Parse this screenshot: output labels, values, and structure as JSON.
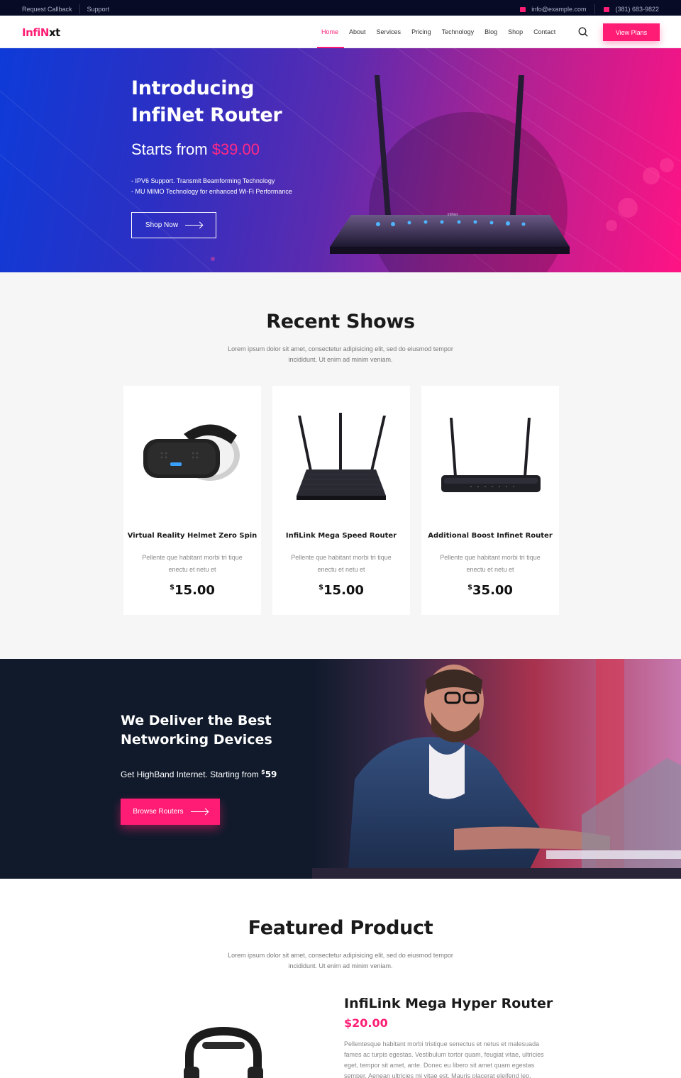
{
  "topbar": {
    "request_callback": "Request Callback",
    "support": "Support",
    "email": "info@example.com",
    "phone": "(381) 683-9822",
    "email_icon": "mail-icon",
    "phone_icon": "phone-icon"
  },
  "header": {
    "logo_part1": "InfiN",
    "logo_part2": "xt",
    "nav": [
      "Home",
      "About",
      "Services",
      "Pricing",
      "Technology",
      "Blog",
      "Shop",
      "Contact"
    ],
    "active_nav": "Home",
    "search_icon": "search-icon",
    "cta": "View Plans"
  },
  "hero": {
    "title": "Introducing InfiNet Router",
    "price_prefix": "Starts from ",
    "price": "$39.00",
    "features": [
      "- IPV6 Support. Transmit Beamforming Technology",
      "- MU MIMO Technology for enhanced Wi-Fi Performance"
    ],
    "button": "Shop Now",
    "router_brand": "InfiNet"
  },
  "recent": {
    "title": "Recent Shows",
    "subtitle": "Lorem ipsum dolor sit amet, consectetur adipisicing elit, sed do eiusmod tempor incididunt. Ut enim ad minim veniam.",
    "products": [
      {
        "name": "Virtual Reality Helmet Zero Spin",
        "desc": "Pellente que habitant morbi tri tique enectu et netu et",
        "currency": "$",
        "amount": "15.00",
        "image": "vr-headset"
      },
      {
        "name": "InfiLink Mega Speed Router",
        "desc": "Pellente que habitant morbi tri tique enectu et netu et",
        "currency": "$",
        "amount": "15.00",
        "image": "router-three-antenna"
      },
      {
        "name": "Additional Boost Infinet Router",
        "desc": "Pellente que habitant morbi tri tique enectu et netu et",
        "currency": "$",
        "amount": "35.00",
        "image": "router-two-antenna"
      }
    ]
  },
  "deliver": {
    "title": "We Deliver the Best Networking Devices",
    "text": "Get HighBand Internet. Starting from ",
    "currency": "$",
    "amount": "59",
    "button": "Browse Routers"
  },
  "featured": {
    "title": "Featured Product",
    "subtitle": "Lorem ipsum dolor sit amet, consectetur adipisicing elit, sed do eiusmod tempor incididunt. Ut enim ad minim veniam.",
    "product_name": "InfiLink Mega Hyper Router",
    "product_price": "$20.00",
    "product_desc": "Pellentesque habitant morbi tristique senectus et netus et malesuada fames ac turpis egestas. Vestibulum tortor quam, feugiat vitae, ultricies eget, tempor sit amet, ante. Donec eu libero sit amet quam egestas semper. Aenean ultricies mi vitae est. Mauris placerat eleifend leo."
  },
  "colors": {
    "accent": "#ff1c74",
    "topbar": "#070b26",
    "dark_section": "#101a2b"
  }
}
